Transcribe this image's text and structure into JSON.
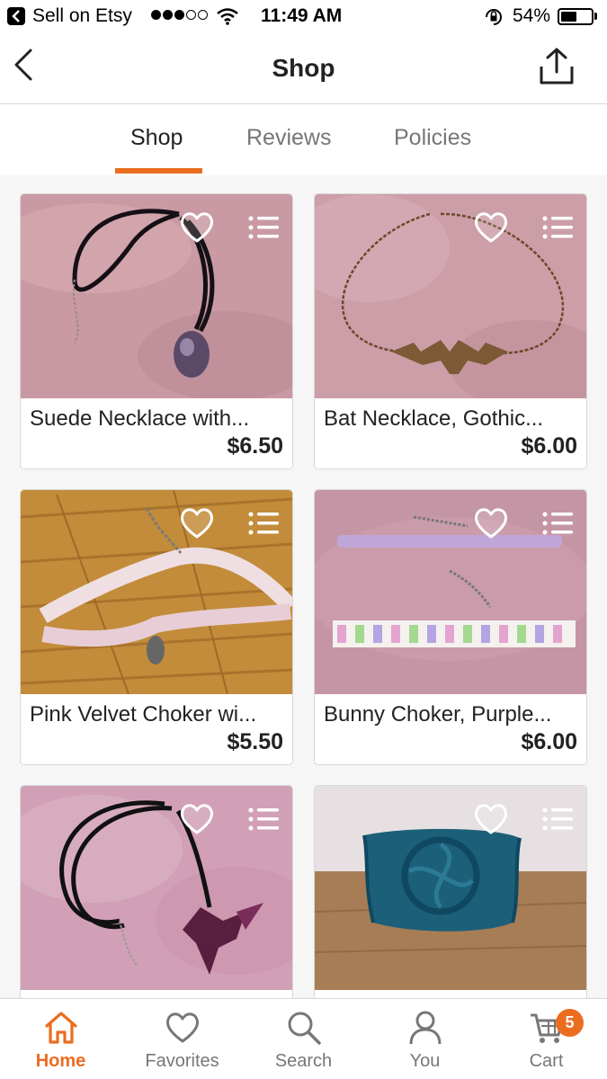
{
  "status_bar": {
    "app_name": "Sell on Etsy",
    "time": "11:49 AM",
    "battery_percent": "54%",
    "battery_level": 0.54,
    "signal_bars_filled": 3,
    "signal_bars_total": 5
  },
  "nav": {
    "title": "Shop",
    "back_icon": "chevron-left-icon",
    "share_icon": "share-icon"
  },
  "tabs": [
    {
      "label": "Shop",
      "active": true
    },
    {
      "label": "Reviews",
      "active": false
    },
    {
      "label": "Policies",
      "active": false
    }
  ],
  "listings": [
    {
      "title": "Suede Necklace with...",
      "price": "$6.50"
    },
    {
      "title": "Bat Necklace, Gothic...",
      "price": "$6.00"
    },
    {
      "title": "Pink Velvet Choker wi...",
      "price": "$5.50"
    },
    {
      "title": "Bunny Choker, Purple...",
      "price": "$6.00"
    },
    {
      "title": "",
      "price": ""
    },
    {
      "title": "",
      "price": ""
    }
  ],
  "bottom_tabs": [
    {
      "label": "Home",
      "icon": "home-icon",
      "active": true
    },
    {
      "label": "Favorites",
      "icon": "heart-icon",
      "active": false
    },
    {
      "label": "Search",
      "icon": "search-icon",
      "active": false
    },
    {
      "label": "You",
      "icon": "user-icon",
      "active": false
    },
    {
      "label": "Cart",
      "icon": "cart-icon",
      "active": false
    }
  ],
  "cart_count": "5",
  "colors": {
    "accent": "#eb6d20",
    "text": "#222222",
    "muted": "#777777"
  }
}
